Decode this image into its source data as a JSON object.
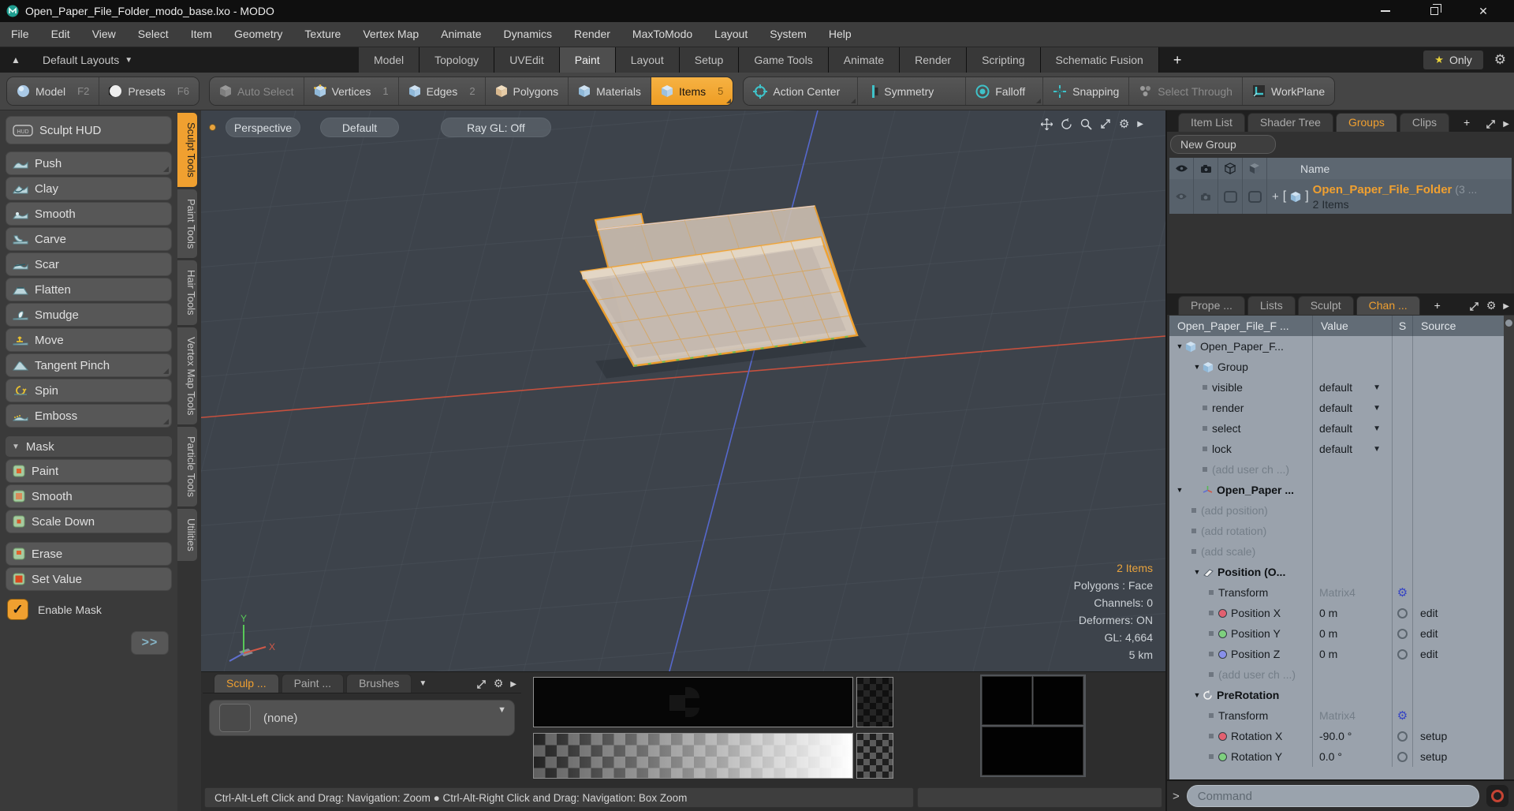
{
  "window": {
    "title": "Open_Paper_File_Folder_modo_base.lxo - MODO",
    "close": "✕"
  },
  "menu": [
    "File",
    "Edit",
    "View",
    "Select",
    "Item",
    "Geometry",
    "Texture",
    "Vertex Map",
    "Animate",
    "Dynamics",
    "Render",
    "MaxToModo",
    "Layout",
    "System",
    "Help"
  ],
  "layout_bar": {
    "layouts_label": "Default Layouts",
    "caret": "▼",
    "tabs": [
      "Model",
      "Topology",
      "UVEdit",
      "Paint",
      "Layout",
      "Setup",
      "Game Tools",
      "Animate",
      "Render",
      "Scripting",
      "Schematic Fusion"
    ],
    "add": "+",
    "only": "Only",
    "star": "★"
  },
  "toolbar": {
    "model": "Model",
    "model_key": "F2",
    "presets": "Presets",
    "presets_key": "F6",
    "auto_select": "Auto Select",
    "vertices": "Vertices",
    "vertices_key": "1",
    "edges": "Edges",
    "edges_key": "2",
    "polygons": "Polygons",
    "materials": "Materials",
    "items": "Items",
    "items_key": "5",
    "action_center": "Action Center",
    "symmetry": "Symmetry",
    "falloff": "Falloff",
    "snapping": "Snapping",
    "select_through": "Select Through",
    "workplane": "WorkPlane"
  },
  "sidebar": {
    "sculpt_hud": "Sculpt HUD",
    "tools": [
      "Push",
      "Clay",
      "Smooth",
      "Carve",
      "Scar",
      "Flatten",
      "Smudge",
      "Move",
      "Tangent Pinch",
      "Spin",
      "Emboss"
    ],
    "mask_label": "Mask",
    "mask_tools": [
      "Paint",
      "Smooth",
      "Scale Down"
    ],
    "mask_tools_b": [
      "Erase",
      "Set Value"
    ],
    "enable_mask": "Enable Mask",
    "check": "✓",
    "more": ">>",
    "vtabs": [
      "Sculpt Tools",
      "Paint Tools",
      "Hair Tools",
      "Vertex Map Tools",
      "Particle Tools",
      "Utilities"
    ]
  },
  "viewport": {
    "buttons": [
      "Perspective",
      "Default",
      "Ray GL: Off"
    ],
    "stats": [
      "2 Items",
      "Polygons : Face",
      "Channels: 0",
      "Deformers: ON",
      "GL: 4,664",
      "5 km"
    ],
    "axis_y": "Y",
    "axis_x": "X"
  },
  "bottom_panel": {
    "tabs": [
      "Sculp ...",
      "Paint ...",
      "Brushes"
    ],
    "caret": "▼",
    "none": "(none)"
  },
  "groups_panel": {
    "tabs": [
      "Item List",
      "Shader Tree",
      "Groups",
      "Clips"
    ],
    "add": "+",
    "new_group": "New Group",
    "name_header": "Name",
    "row": {
      "plus": "+",
      "open_bracket": "[",
      "close_bracket": "]",
      "name": "Open_Paper_File_Folder",
      "suffix": "(3 ...",
      "count": "2 Items"
    }
  },
  "channels_panel": {
    "tabs": [
      "Prope ...",
      "Lists",
      "Sculpt",
      "Chan ..."
    ],
    "add": "+",
    "headers": {
      "name": "Open_Paper_File_F ...",
      "value": "Value",
      "s": "S",
      "source": "Source"
    },
    "rows": [
      {
        "label": "Open_Paper_F...",
        "value": "",
        "source": ""
      },
      {
        "label": "Group",
        "value": "",
        "source": ""
      },
      {
        "label": "visible",
        "value": "default",
        "source": ""
      },
      {
        "label": "render",
        "value": "default",
        "source": ""
      },
      {
        "label": "select",
        "value": "default",
        "source": ""
      },
      {
        "label": "lock",
        "value": "default",
        "source": ""
      },
      {
        "label": "(add user ch ...)",
        "value": "",
        "source": ""
      },
      {
        "label": "Open_Paper ...",
        "value": "",
        "source": ""
      },
      {
        "label": "(add position)",
        "value": "",
        "source": ""
      },
      {
        "label": "(add rotation)",
        "value": "",
        "source": ""
      },
      {
        "label": "(add scale)",
        "value": "",
        "source": ""
      },
      {
        "label": "Position (O...",
        "value": "",
        "source": ""
      },
      {
        "label": "Transform",
        "value": "Matrix4",
        "source": ""
      },
      {
        "label": "Position X",
        "value": "0 m",
        "source": "edit"
      },
      {
        "label": "Position Y",
        "value": "0 m",
        "source": "edit"
      },
      {
        "label": "Position Z",
        "value": "0 m",
        "source": "edit"
      },
      {
        "label": "(add user ch ...)",
        "value": "",
        "source": ""
      },
      {
        "label": "PreRotation",
        "value": "",
        "source": ""
      },
      {
        "label": "Transform",
        "value": "Matrix4",
        "source": ""
      },
      {
        "label": "Rotation X",
        "value": "-90.0 °",
        "source": "setup"
      },
      {
        "label": "Rotation Y",
        "value": "0.0 °",
        "source": "setup"
      }
    ]
  },
  "status_bar": {
    "text": "Ctrl-Alt-Left Click and Drag: Navigation: Zoom ● Ctrl-Alt-Right Click and Drag: Navigation: Box Zoom"
  },
  "command_bar": {
    "prompt": ">",
    "placeholder": "Command"
  },
  "colors": {
    "accent_orange": "#f0a030",
    "viewport_bg": "#3d434b",
    "axis_red": "#c6503e",
    "axis_blue": "#5668cc",
    "teal_icon": "#3fc2c9"
  }
}
